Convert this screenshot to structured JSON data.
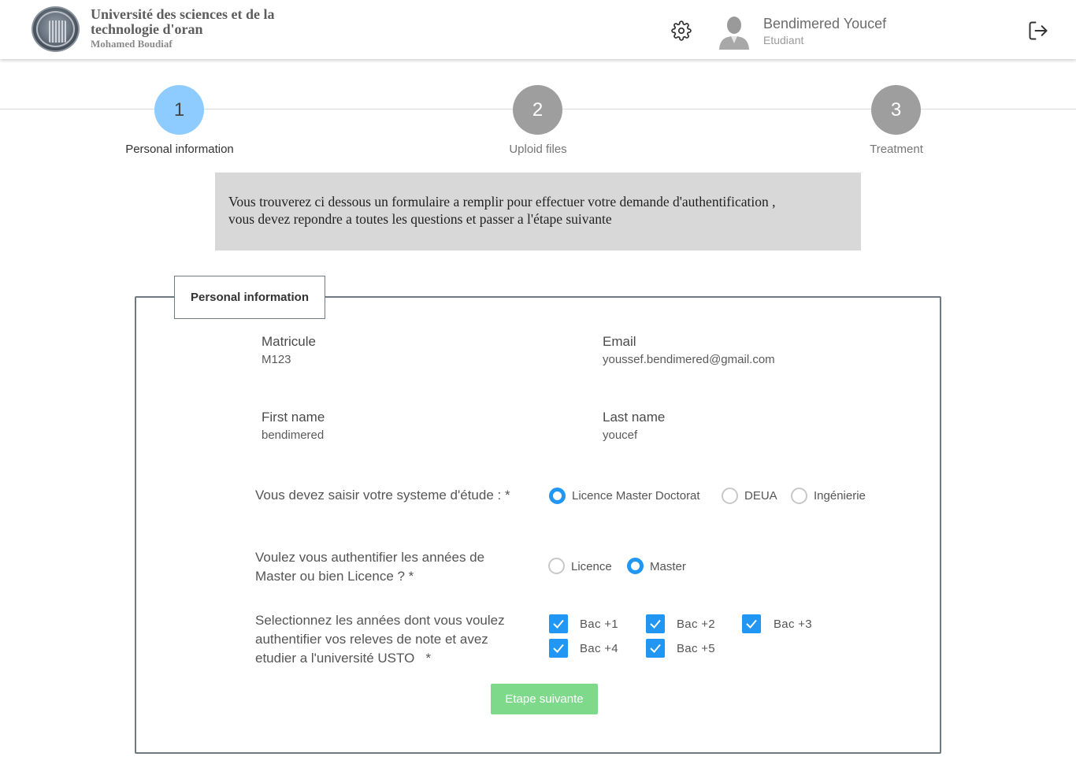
{
  "header": {
    "university_line1": "Université des sciences et de la",
    "university_line2": "technologie d'oran",
    "university_line3": "Mohamed Boudiaf",
    "user_name": "Bendimered Youcef",
    "user_role": "Etudiant",
    "icons": {
      "settings": "gear-icon",
      "logout": "logout-icon",
      "avatar": "user-avatar"
    }
  },
  "stepper": {
    "steps": [
      {
        "number": "1",
        "label": "Personal information",
        "state": "active"
      },
      {
        "number": "2",
        "label": "Uploid files",
        "state": "idle"
      },
      {
        "number": "3",
        "label": "Treatment",
        "state": "idle"
      }
    ]
  },
  "notice": {
    "line1": "Vous trouverez ci dessous un formulaire a remplir pour effectuer votre demande d'authentification ,",
    "line2": "vous devez repondre a toutes les questions et passer a l'étape suivante"
  },
  "form": {
    "legend": "Personal information",
    "matricule_label": "Matricule",
    "matricule_value": "M123",
    "email_label": "Email",
    "email_value": "youssef.bendimered@gmail.com",
    "firstname_label": "First name",
    "firstname_value": "bendimered",
    "lastname_label": "Last name",
    "lastname_value": "youcef",
    "system_question": "Vous devez saisir votre systeme d'étude : *",
    "system_options": [
      {
        "label": "Licence Master Doctorat",
        "checked": true
      },
      {
        "label": "DEUA",
        "checked": false
      },
      {
        "label": "Ingénierie",
        "checked": false
      }
    ],
    "years_question_line1": "Voulez vous authentifier les années de",
    "years_question_line2": "Master ou bien Licence ? *",
    "years_options": [
      {
        "label": "Licence",
        "checked": false
      },
      {
        "label": "Master",
        "checked": true
      }
    ],
    "select_question_line1": "Selectionnez les années dont vous voulez",
    "select_question_line2": "authentifier vos releves de note et avez",
    "select_question_line3": "etudier a l'université USTO   *",
    "year_checkboxes": [
      {
        "label": "Bac +1",
        "checked": true
      },
      {
        "label": "Bac +2",
        "checked": true
      },
      {
        "label": "Bac +3",
        "checked": true
      },
      {
        "label": "Bac +4",
        "checked": true
      },
      {
        "label": "Bac +5",
        "checked": true
      }
    ],
    "next_button": "Etape suivante"
  },
  "colors": {
    "accent": "#2196f3",
    "step_active": "#8ecbff",
    "step_idle": "#9e9e9e",
    "button": "#7ed98b",
    "notice_bg": "#d8d8d8"
  }
}
